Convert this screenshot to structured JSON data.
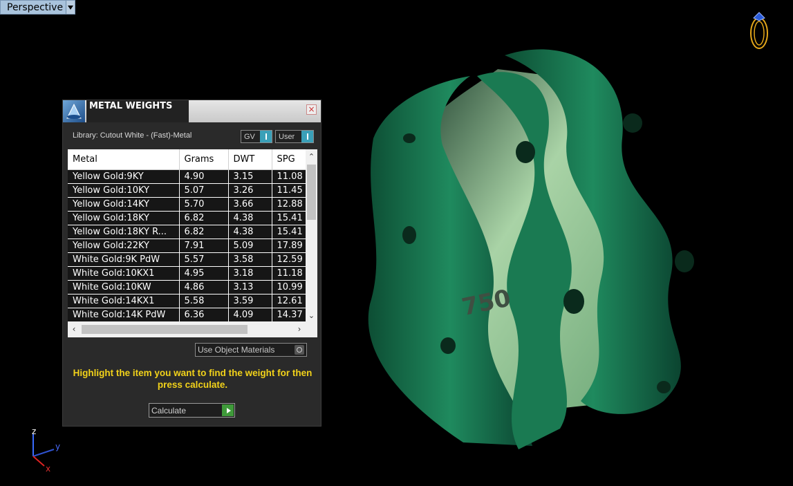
{
  "viewport": {
    "label": "Perspective"
  },
  "panel": {
    "title": "METAL WEIGHTS",
    "close_label": "×",
    "library": "Library: Cutout White - (Fast)-Metal",
    "gv_label": "GV",
    "user_label": "User",
    "columns": [
      "Metal",
      "Grams",
      "DWT",
      "SPG"
    ],
    "rows": [
      [
        "Yellow Gold:9KY",
        "4.90",
        "3.15",
        "11.08"
      ],
      [
        "Yellow Gold:10KY",
        "5.07",
        "3.26",
        "11.45"
      ],
      [
        "Yellow Gold:14KY",
        "5.70",
        "3.66",
        "12.88"
      ],
      [
        "Yellow Gold:18KY",
        "6.82",
        "4.38",
        "15.41"
      ],
      [
        "Yellow Gold:18KY R...",
        "6.82",
        "4.38",
        "15.41"
      ],
      [
        "Yellow Gold:22KY",
        "7.91",
        "5.09",
        "17.89"
      ],
      [
        "White Gold:9K PdW",
        "5.57",
        "3.58",
        "12.59"
      ],
      [
        "White Gold:10KX1",
        "4.95",
        "3.18",
        "11.18"
      ],
      [
        "White Gold:10KW",
        "4.86",
        "3.13",
        "10.99"
      ],
      [
        "White Gold:14KX1",
        "5.58",
        "3.59",
        "12.61"
      ],
      [
        "White Gold:14K PdW",
        "6.36",
        "4.09",
        "14.37"
      ]
    ],
    "use_object_materials": "Use Object Materials",
    "hint": "Highlight the item you want to find the weight for then press calculate.",
    "calculate_label": "Calculate"
  },
  "model": {
    "stamp": "750"
  },
  "axis": {
    "z": "z",
    "y": "y",
    "x": "x"
  },
  "colors": {
    "ring": "#1d7a55",
    "ring_inner": "#a9d3a6",
    "hint": "#f2d21a",
    "panel_bg": "#2a2a2a"
  }
}
